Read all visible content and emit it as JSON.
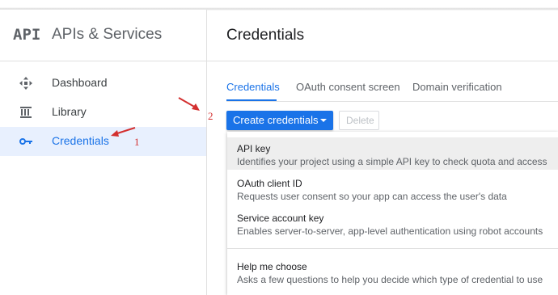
{
  "sidebar": {
    "logo_text": "API",
    "title": "APIs & Services",
    "items": [
      {
        "label": "Dashboard",
        "icon": "dashboard-icon"
      },
      {
        "label": "Library",
        "icon": "library-icon"
      },
      {
        "label": "Credentials",
        "icon": "key-icon",
        "active": true
      }
    ]
  },
  "main": {
    "title": "Credentials",
    "tabs": [
      {
        "label": "Credentials",
        "active": true
      },
      {
        "label": "OAuth consent screen"
      },
      {
        "label": "Domain verification"
      }
    ],
    "create_button_label": "Create credentials",
    "delete_button_label": "Delete"
  },
  "menu": {
    "items": [
      {
        "title": "API key",
        "description": "Identifies your project using a simple API key to check quota and access"
      },
      {
        "title": "OAuth client ID",
        "description": "Requests user consent so your app can access the user's data"
      },
      {
        "title": "Service account key",
        "description": "Enables server-to-server, app-level authentication using robot accounts"
      },
      {
        "title": "Help me choose",
        "description": "Asks a few questions to help you decide which type of credential to use"
      }
    ]
  },
  "annotations": {
    "step1": "1",
    "step2": "2"
  },
  "colors": {
    "accent": "#1a73e8",
    "annotation": "#d32f2f",
    "active_bg": "#e8f0fe"
  }
}
